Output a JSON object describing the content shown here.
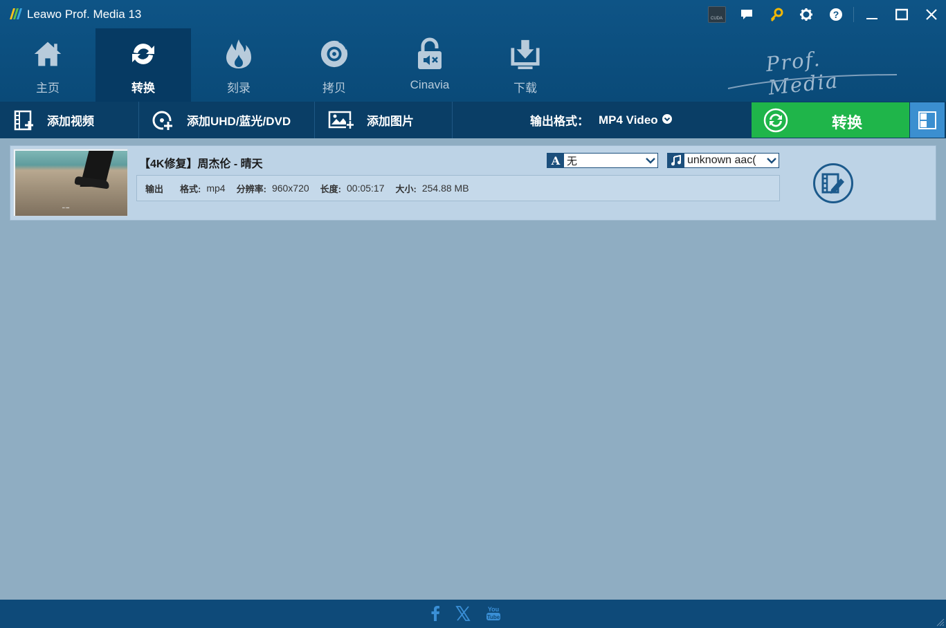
{
  "app": {
    "title": "Leawo Prof. Media 13"
  },
  "window_controls": {
    "cuda_label": "CUDA",
    "icons": [
      "cuda-icon",
      "chat-icon",
      "key-icon",
      "gear-icon",
      "help-icon",
      "minimize-icon",
      "maximize-icon",
      "close-icon"
    ]
  },
  "nav": {
    "tabs": [
      {
        "label": "主页",
        "icon": "home-icon",
        "active": false
      },
      {
        "label": "转换",
        "icon": "convert-icon",
        "active": true
      },
      {
        "label": "刻录",
        "icon": "burn-icon",
        "active": false
      },
      {
        "label": "拷贝",
        "icon": "copy-disc-icon",
        "active": false
      },
      {
        "label": "Cinavia",
        "icon": "cinavia-icon",
        "active": false
      },
      {
        "label": "下载",
        "icon": "download-icon",
        "active": false
      }
    ],
    "brand": "Prof. Media"
  },
  "toolbar": {
    "add_video": "添加视频",
    "add_disc": "添加UHD/蓝光/DVD",
    "add_photo": "添加图片",
    "output_format_label": "输出格式：",
    "output_format_value": "MP4 Video",
    "convert_label": "转换"
  },
  "file": {
    "title": "【4K修复】周杰伦 - 晴天",
    "subtitle_icon_letter": "A",
    "subtitle_value": "无",
    "audio_value": "unknown aac(",
    "output_label": "输出",
    "format_label": "格式:",
    "format_value": "mp4",
    "resolution_label": "分辨率:",
    "resolution_value": "960x720",
    "duration_label": "长度:",
    "duration_value": "00:05:17",
    "size_label": "大小:",
    "size_value": "254.88 MB"
  },
  "footer": {
    "social": [
      "facebook-icon",
      "x-icon",
      "youtube-icon"
    ]
  },
  "colors": {
    "title_bar": "#0e5486",
    "active_tab": "#063a63",
    "toolbar": "#0a3e66",
    "convert_green": "#1fb54a",
    "panel_blue": "#3b8fd0",
    "content_bg": "#8fadc2",
    "item_bg": "#bdd3e6"
  }
}
